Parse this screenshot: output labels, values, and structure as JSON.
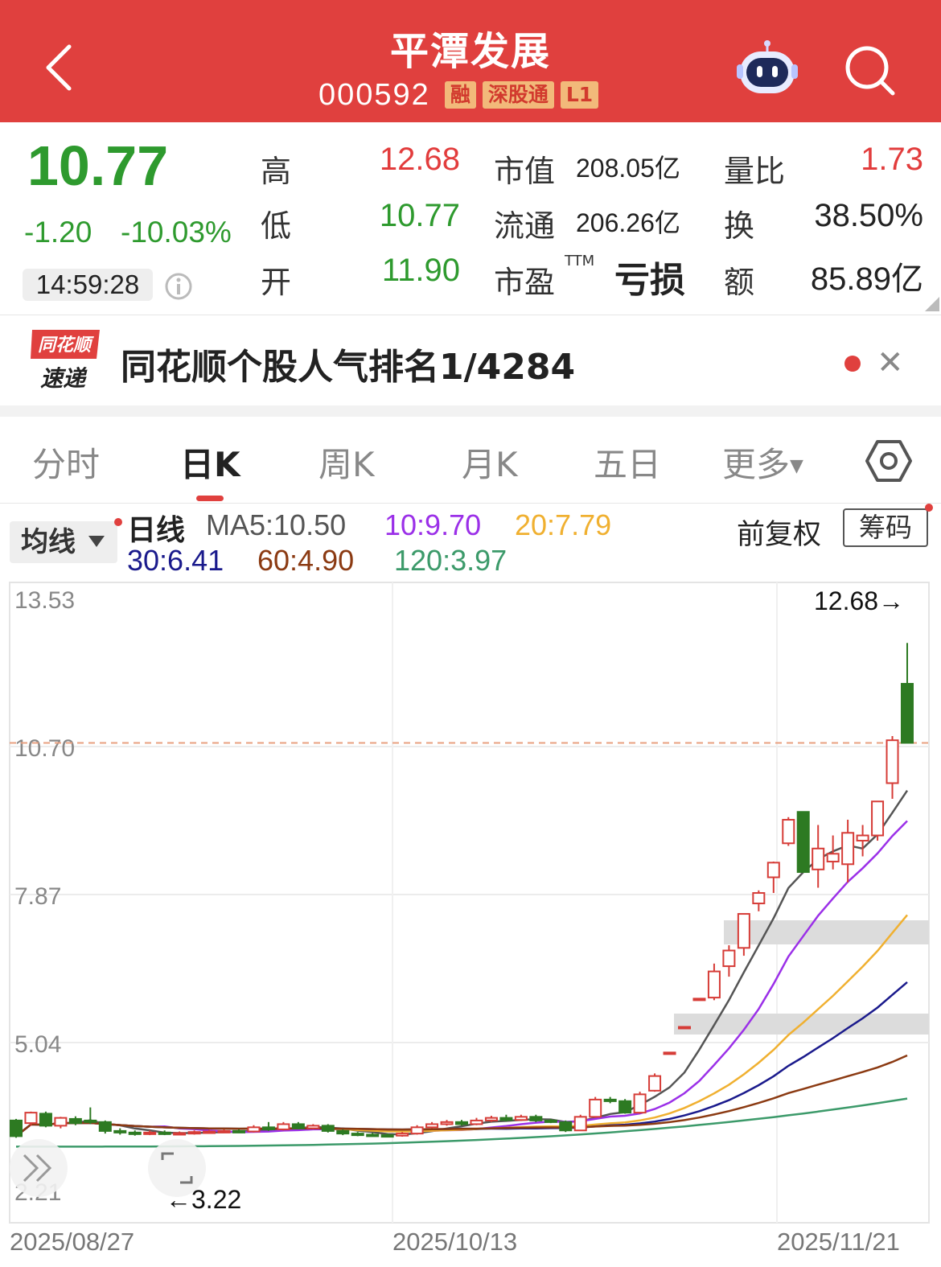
{
  "header": {
    "title": "平潭发展",
    "code": "000592",
    "tags": [
      "融",
      "深股通",
      "L1"
    ]
  },
  "quote": {
    "price": "10.77",
    "change": "-1.20",
    "change_pct": "-10.03%",
    "time": "14:59:28",
    "high_label": "高",
    "high": "12.68",
    "low_label": "低",
    "low": "10.77",
    "open_label": "开",
    "open": "11.90",
    "mcap_label": "市值",
    "mcap": "208.05亿",
    "float_label": "流通",
    "float": "206.26亿",
    "pe_label": "市盈",
    "pe_sup": "TTM",
    "pe": "亏损",
    "vol_ratio_label": "量比",
    "vol_ratio": "1.73",
    "turnover_label": "换",
    "turnover": "38.50%",
    "amount_label": "额",
    "amount": "85.89亿"
  },
  "banner": {
    "logo_top": "同花顺",
    "logo_bottom": "速递",
    "text": "同花顺个股人气排名1/4284"
  },
  "tabs": [
    "分时",
    "日K",
    "周K",
    "月K",
    "五日",
    "更多"
  ],
  "chart_header": {
    "ma_button": "均线",
    "period": "日线",
    "ma5": "MA5:10.50",
    "ma10": "10:9.70",
    "ma20": "20:7.79",
    "ma30": "30:6.41",
    "ma60": "60:4.90",
    "ma120": "120:3.97",
    "adjust": "前复权",
    "chips": "筹码"
  },
  "colors": {
    "up": "#d63c37",
    "down": "#2d7a22",
    "ma5": "#555555",
    "ma10": "#9b30e8",
    "ma20": "#f0b030",
    "ma30": "#1a1a8c",
    "ma60": "#8b3a12",
    "ma120": "#3c9a6a"
  },
  "chart_data": {
    "type": "candlestick",
    "y_ticks": [
      "13.53",
      "10.70",
      "7.87",
      "5.04",
      "2.21"
    ],
    "ylim": [
      2.21,
      13.53
    ],
    "x_labels": [
      "2025/08/27",
      "2025/10/13",
      "2025/11/21"
    ],
    "high_label": "12.68→",
    "low_label": "←3.22",
    "last_close_line": 10.77,
    "candles": [
      [
        3.55,
        3.25,
        3.58,
        3.22
      ],
      [
        3.5,
        3.7,
        3.72,
        3.45
      ],
      [
        3.68,
        3.45,
        3.72,
        3.42
      ],
      [
        3.45,
        3.6,
        3.62,
        3.4
      ],
      [
        3.58,
        3.5,
        3.63,
        3.46
      ],
      [
        3.55,
        3.52,
        3.8,
        3.48
      ],
      [
        3.52,
        3.35,
        3.55,
        3.3
      ],
      [
        3.35,
        3.32,
        3.4,
        3.28
      ],
      [
        3.32,
        3.3,
        3.36,
        3.26
      ],
      [
        3.3,
        3.32,
        3.36,
        3.27
      ],
      [
        3.32,
        3.3,
        3.36,
        3.27
      ],
      [
        3.3,
        3.31,
        3.34,
        3.27
      ],
      [
        3.31,
        3.33,
        3.36,
        3.28
      ],
      [
        3.33,
        3.34,
        3.37,
        3.3
      ],
      [
        3.34,
        3.35,
        3.38,
        3.31
      ],
      [
        3.35,
        3.34,
        3.38,
        3.31
      ],
      [
        3.34,
        3.42,
        3.46,
        3.32
      ],
      [
        3.42,
        3.38,
        3.52,
        3.35
      ],
      [
        3.38,
        3.48,
        3.52,
        3.36
      ],
      [
        3.48,
        3.4,
        3.52,
        3.38
      ],
      [
        3.4,
        3.45,
        3.48,
        3.38
      ],
      [
        3.45,
        3.35,
        3.48,
        3.32
      ],
      [
        3.35,
        3.3,
        3.38,
        3.27
      ],
      [
        3.3,
        3.28,
        3.33,
        3.25
      ],
      [
        3.28,
        3.27,
        3.31,
        3.24
      ],
      [
        3.27,
        3.26,
        3.3,
        3.23
      ],
      [
        3.26,
        3.3,
        3.33,
        3.24
      ],
      [
        3.3,
        3.42,
        3.46,
        3.28
      ],
      [
        3.42,
        3.48,
        3.52,
        3.4
      ],
      [
        3.48,
        3.52,
        3.56,
        3.45
      ],
      [
        3.52,
        3.48,
        3.56,
        3.45
      ],
      [
        3.48,
        3.55,
        3.6,
        3.46
      ],
      [
        3.55,
        3.6,
        3.64,
        3.52
      ],
      [
        3.6,
        3.56,
        3.66,
        3.53
      ],
      [
        3.56,
        3.62,
        3.66,
        3.54
      ],
      [
        3.62,
        3.55,
        3.66,
        3.52
      ],
      [
        3.55,
        3.52,
        3.58,
        3.5
      ],
      [
        3.52,
        3.36,
        3.55,
        3.33
      ],
      [
        3.36,
        3.62,
        3.66,
        3.35
      ],
      [
        3.62,
        3.95,
        4.0,
        3.6
      ],
      [
        3.95,
        3.92,
        4.0,
        3.88
      ],
      [
        3.92,
        3.7,
        3.96,
        3.68
      ],
      [
        3.7,
        4.05,
        4.1,
        3.68
      ],
      [
        4.12,
        4.4,
        4.45,
        4.1
      ],
      [
        4.84,
        4.85,
        4.86,
        4.83
      ],
      [
        5.33,
        5.34,
        5.35,
        5.32
      ],
      [
        5.87,
        5.88,
        5.89,
        5.86
      ],
      [
        5.9,
        6.4,
        6.55,
        5.85
      ],
      [
        6.5,
        6.8,
        6.9,
        6.3
      ],
      [
        6.85,
        7.5,
        7.5,
        6.7
      ],
      [
        7.7,
        7.9,
        7.95,
        7.55
      ],
      [
        8.2,
        8.48,
        8.5,
        7.9
      ],
      [
        8.85,
        9.3,
        9.35,
        8.8
      ],
      [
        9.45,
        8.3,
        9.45,
        8.3
      ],
      [
        8.35,
        8.75,
        9.2,
        8.0
      ],
      [
        8.5,
        8.65,
        9.0,
        8.35
      ],
      [
        8.45,
        9.05,
        9.3,
        8.1
      ],
      [
        8.9,
        9.0,
        9.2,
        8.6
      ],
      [
        9.0,
        9.65,
        9.65,
        8.9
      ],
      [
        10.0,
        10.82,
        10.9,
        9.7
      ],
      [
        11.9,
        10.77,
        12.68,
        10.77
      ]
    ]
  }
}
